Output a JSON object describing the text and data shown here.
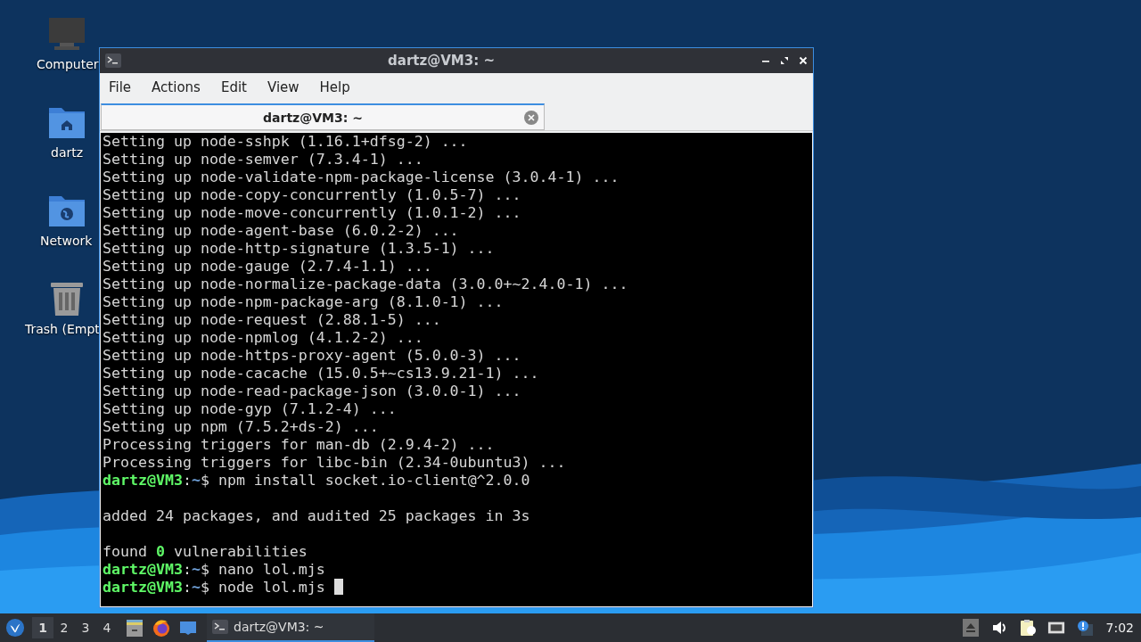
{
  "desktop_icons": [
    {
      "kind": "computer",
      "label": "Computer"
    },
    {
      "kind": "home",
      "label": "dartz"
    },
    {
      "kind": "network",
      "label": "Network"
    },
    {
      "kind": "trash",
      "label": "Trash (Empt"
    }
  ],
  "window": {
    "title": "dartz@VM3: ~",
    "menu": [
      "File",
      "Actions",
      "Edit",
      "View",
      "Help"
    ],
    "tabs": [
      {
        "label": "dartz@VM3: ~",
        "selected": true
      }
    ],
    "terminal": {
      "lines": [
        {
          "kind": "text",
          "text": "Setting up node-sshpk (1.16.1+dfsg-2) ..."
        },
        {
          "kind": "text",
          "text": "Setting up node-semver (7.3.4-1) ..."
        },
        {
          "kind": "text",
          "text": "Setting up node-validate-npm-package-license (3.0.4-1) ..."
        },
        {
          "kind": "text",
          "text": "Setting up node-copy-concurrently (1.0.5-7) ..."
        },
        {
          "kind": "text",
          "text": "Setting up node-move-concurrently (1.0.1-2) ..."
        },
        {
          "kind": "text",
          "text": "Setting up node-agent-base (6.0.2-2) ..."
        },
        {
          "kind": "text",
          "text": "Setting up node-http-signature (1.3.5-1) ..."
        },
        {
          "kind": "text",
          "text": "Setting up node-gauge (2.7.4-1.1) ..."
        },
        {
          "kind": "text",
          "text": "Setting up node-normalize-package-data (3.0.0+~2.4.0-1) ..."
        },
        {
          "kind": "text",
          "text": "Setting up node-npm-package-arg (8.1.0-1) ..."
        },
        {
          "kind": "text",
          "text": "Setting up node-request (2.88.1-5) ..."
        },
        {
          "kind": "text",
          "text": "Setting up node-npmlog (4.1.2-2) ..."
        },
        {
          "kind": "text",
          "text": "Setting up node-https-proxy-agent (5.0.0-3) ..."
        },
        {
          "kind": "text",
          "text": "Setting up node-cacache (15.0.5+~cs13.9.21-1) ..."
        },
        {
          "kind": "text",
          "text": "Setting up node-read-package-json (3.0.0-1) ..."
        },
        {
          "kind": "text",
          "text": "Setting up node-gyp (7.1.2-4) ..."
        },
        {
          "kind": "text",
          "text": "Setting up npm (7.5.2+ds-2) ..."
        },
        {
          "kind": "text",
          "text": "Processing triggers for man-db (2.9.4-2) ..."
        },
        {
          "kind": "text",
          "text": "Processing triggers for libc-bin (2.34-0ubuntu3) ..."
        },
        {
          "kind": "prompt",
          "user": "dartz@VM3",
          "sep": ":",
          "path": "~",
          "command": "$ npm install socket.io-client@^2.0.0"
        },
        {
          "kind": "blank"
        },
        {
          "kind": "text",
          "text": "added 24 packages, and audited 25 packages in 3s"
        },
        {
          "kind": "blank"
        },
        {
          "kind": "text",
          "text": "found **0** vulnerabilities"
        },
        {
          "kind": "prompt",
          "user": "dartz@VM3",
          "sep": ":",
          "path": "~",
          "command": "$ nano lol.mjs"
        },
        {
          "kind": "prompt",
          "user": "dartz@VM3",
          "sep": ":",
          "path": "~",
          "command": "$ node lol.mjs",
          "cursor": true
        }
      ]
    }
  },
  "taskbar": {
    "workspaces": [
      {
        "label": "1",
        "selected": true
      },
      {
        "label": "2",
        "selected": false
      },
      {
        "label": "3",
        "selected": false
      },
      {
        "label": "4",
        "selected": false
      }
    ],
    "tasks": [
      {
        "label": "dartz@VM3: ~",
        "selected": true
      }
    ],
    "clock": "7:02"
  }
}
